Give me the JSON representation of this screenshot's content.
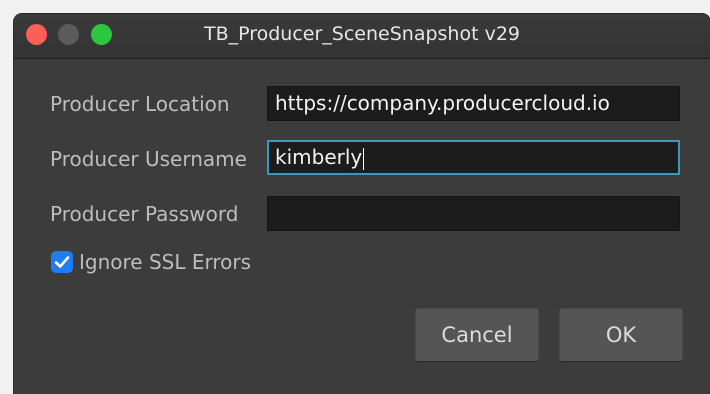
{
  "window": {
    "title": "TB_Producer_SceneSnapshot v29"
  },
  "form": {
    "location_label": "Producer Location",
    "location_value": "https://company.producercloud.io",
    "username_label": "Producer Username",
    "username_value": "kimberly",
    "password_label": "Producer Password",
    "password_value": "",
    "ssl_label": "Ignore SSL Errors",
    "ssl_checked": true
  },
  "buttons": {
    "cancel": "Cancel",
    "ok": "OK"
  },
  "colors": {
    "background": "#3c3c3c",
    "field": "#1c1c1c",
    "focus_ring": "#3a97bf",
    "checkbox": "#1f7cf2",
    "button": "#555555"
  }
}
